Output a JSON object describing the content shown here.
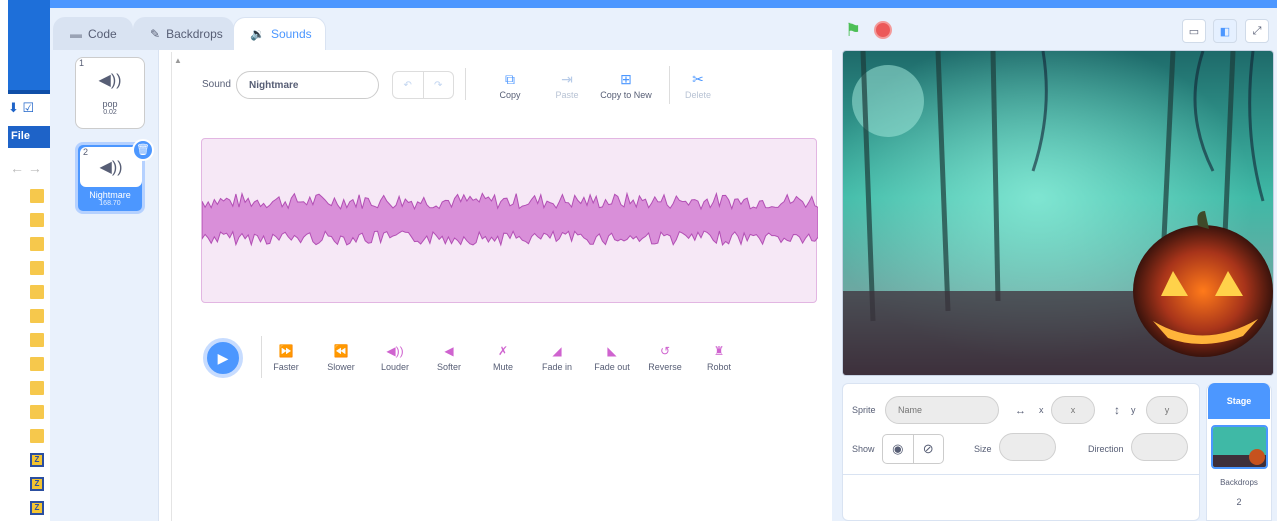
{
  "tabs": [
    {
      "label": "Code",
      "icon": "code-icon"
    },
    {
      "label": "Backdrops",
      "icon": "brush-icon"
    },
    {
      "label": "Sounds",
      "icon": "sound-icon"
    }
  ],
  "left_app": {
    "menu_file": "File"
  },
  "sounds": [
    {
      "index": "1",
      "name": "pop",
      "duration": "0.02"
    },
    {
      "index": "2",
      "name": "Nightmare",
      "duration": "168.70",
      "selected": true
    }
  ],
  "editor": {
    "sound_label": "Sound",
    "sound_name": "Nightmare",
    "toolbar": {
      "copy": "Copy",
      "paste": "Paste",
      "copy_to_new": "Copy to New",
      "delete": "Delete"
    },
    "effects": [
      "Faster",
      "Slower",
      "Louder",
      "Softer",
      "Mute",
      "Fade in",
      "Fade out",
      "Reverse",
      "Robot"
    ],
    "accent_color": "#cf63cf"
  },
  "sprite_info": {
    "sprite_label": "Sprite",
    "name_placeholder": "Name",
    "x_label": "x",
    "x_placeholder": "x",
    "y_label": "y",
    "y_placeholder": "y",
    "show_label": "Show",
    "size_label": "Size",
    "direction_label": "Direction"
  },
  "stage_selector": {
    "title": "Stage",
    "backdrops_label": "Backdrops",
    "backdrops_count": "2"
  },
  "colors": {
    "primary": "#4c97ff",
    "sound": "#cf63cf",
    "flag": "#4cbf56",
    "stop": "#ec5959"
  }
}
